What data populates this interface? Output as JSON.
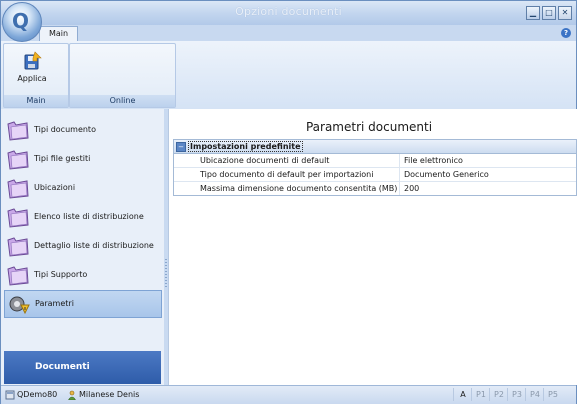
{
  "window": {
    "title": "Opzioni documenti",
    "orb_letter": "Q"
  },
  "ribbon": {
    "tab": "Main",
    "groups": [
      {
        "label": "Main",
        "button": "Applica"
      },
      {
        "label": "Online"
      }
    ]
  },
  "nav": {
    "items": [
      {
        "label": "Tipi documento",
        "icon": "folder-icon"
      },
      {
        "label": "Tipi file gestiti",
        "icon": "folder-icon"
      },
      {
        "label": "Ubicazioni",
        "icon": "folder-icon"
      },
      {
        "label": "Elenco liste di distribuzione",
        "icon": "folder-icon"
      },
      {
        "label": "Dettaglio liste di distribuzione",
        "icon": "folder-icon"
      },
      {
        "label": "Tipi Supporto",
        "icon": "folder-icon"
      },
      {
        "label": "Parametri",
        "icon": "settings-gear-icon",
        "selected": true
      }
    ],
    "footer": "Documenti"
  },
  "content": {
    "title": "Parametri documenti",
    "group_header": "Impostazioni predefinite",
    "rows": [
      {
        "key": "Ubicazione documenti di default",
        "value": "File elettronico"
      },
      {
        "key": "Tipo documento di default per importazioni",
        "value": "Documento Generico"
      },
      {
        "key": "Massima dimensione documento consentita (MB)",
        "value": "200"
      }
    ]
  },
  "statusbar": {
    "db": "QDemo80",
    "user": "Milanese Denis",
    "indicators": [
      "A",
      "P1",
      "P2",
      "P3",
      "P4",
      "P5"
    ]
  },
  "colors": {
    "accent": "#2e5ca9",
    "selection": "#a8c5ea"
  }
}
